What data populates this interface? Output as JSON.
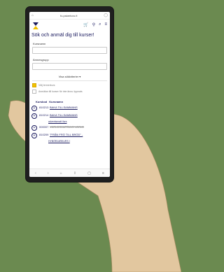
{
  "browser": {
    "url": "fu.pskertoro.fi"
  },
  "header": {
    "menu_icon": "hamburger-icon"
  },
  "page": {
    "title": "Sök och anmäl dig till kurser!",
    "fields": [
      {
        "label": "Kursnamn"
      },
      {
        "label": "Ämnesgrupp"
      }
    ],
    "filter_button": "Visa sökkriterier ▾",
    "options": [
      {
        "label": "Välj termerkurs",
        "checked": true
      },
      {
        "label": "Anmälan till kurser för inte ännu öppnats",
        "checked": false
      }
    ],
    "table": {
      "headers": [
        "Kurskod",
        "Kursnamn"
      ],
      "rows": [
        {
          "code": "810213",
          "name": "BAKA TILLSAMMANS"
        },
        {
          "code": "810214",
          "name": "BAKA TILLSAMMANS",
          "sub": "adventsmatt ilurs"
        },
        {
          "code": "000007",
          "name": "VÄRLDSKARTANS VÄRLD",
          "struck": true
        },
        {
          "code": "810209",
          "name": "\"FRÅN FRÖ TILL BRÖD\" -",
          "sub": "HYBÖRJARKURS I"
        }
      ]
    }
  },
  "colors": {
    "background": "#6b8a50",
    "brand_navy": "#1a1a5e",
    "brand_yellow": "#f2c100",
    "hand": "#e2c79f"
  }
}
